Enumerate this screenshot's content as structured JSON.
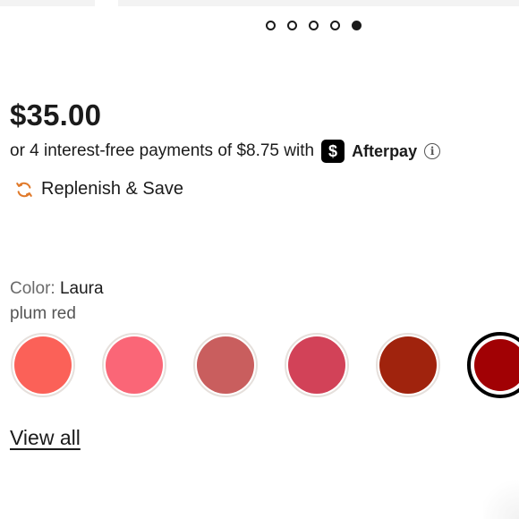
{
  "carousel": {
    "dot_count": 5,
    "active_index": 4,
    "dots": [
      {
        "icon": "carousel-dot-icon",
        "active": false
      },
      {
        "icon": "carousel-dot-icon",
        "active": false
      },
      {
        "icon": "carousel-dot-icon",
        "active": false
      },
      {
        "icon": "carousel-dot-icon",
        "active": false
      },
      {
        "icon": "carousel-dot-icon",
        "active": true
      }
    ]
  },
  "product": {
    "price": "$35.00"
  },
  "afterpay": {
    "text": "or 4 interest-free payments of $8.75 with",
    "logo_glyph": "$",
    "brand": "Afterpay",
    "info_glyph": "i",
    "logo_icon": "afterpay-logo-icon",
    "info_icon": "info-icon"
  },
  "replenish": {
    "label": "Replenish & Save",
    "icon": "refresh-icon",
    "icon_color": "#e07a2b"
  },
  "color": {
    "label": "Color:",
    "selected_name": "Laura",
    "selected_description": "plum red"
  },
  "swatches": [
    {
      "color": "#fb6158",
      "selected": false
    },
    {
      "color": "#fa6677",
      "selected": false
    },
    {
      "color": "#c95e5e",
      "selected": false
    },
    {
      "color": "#d24258",
      "selected": false
    },
    {
      "color": "#a0230d",
      "selected": false
    },
    {
      "color": "#a10104",
      "selected": true
    }
  ],
  "view_all": {
    "label": "View all"
  }
}
